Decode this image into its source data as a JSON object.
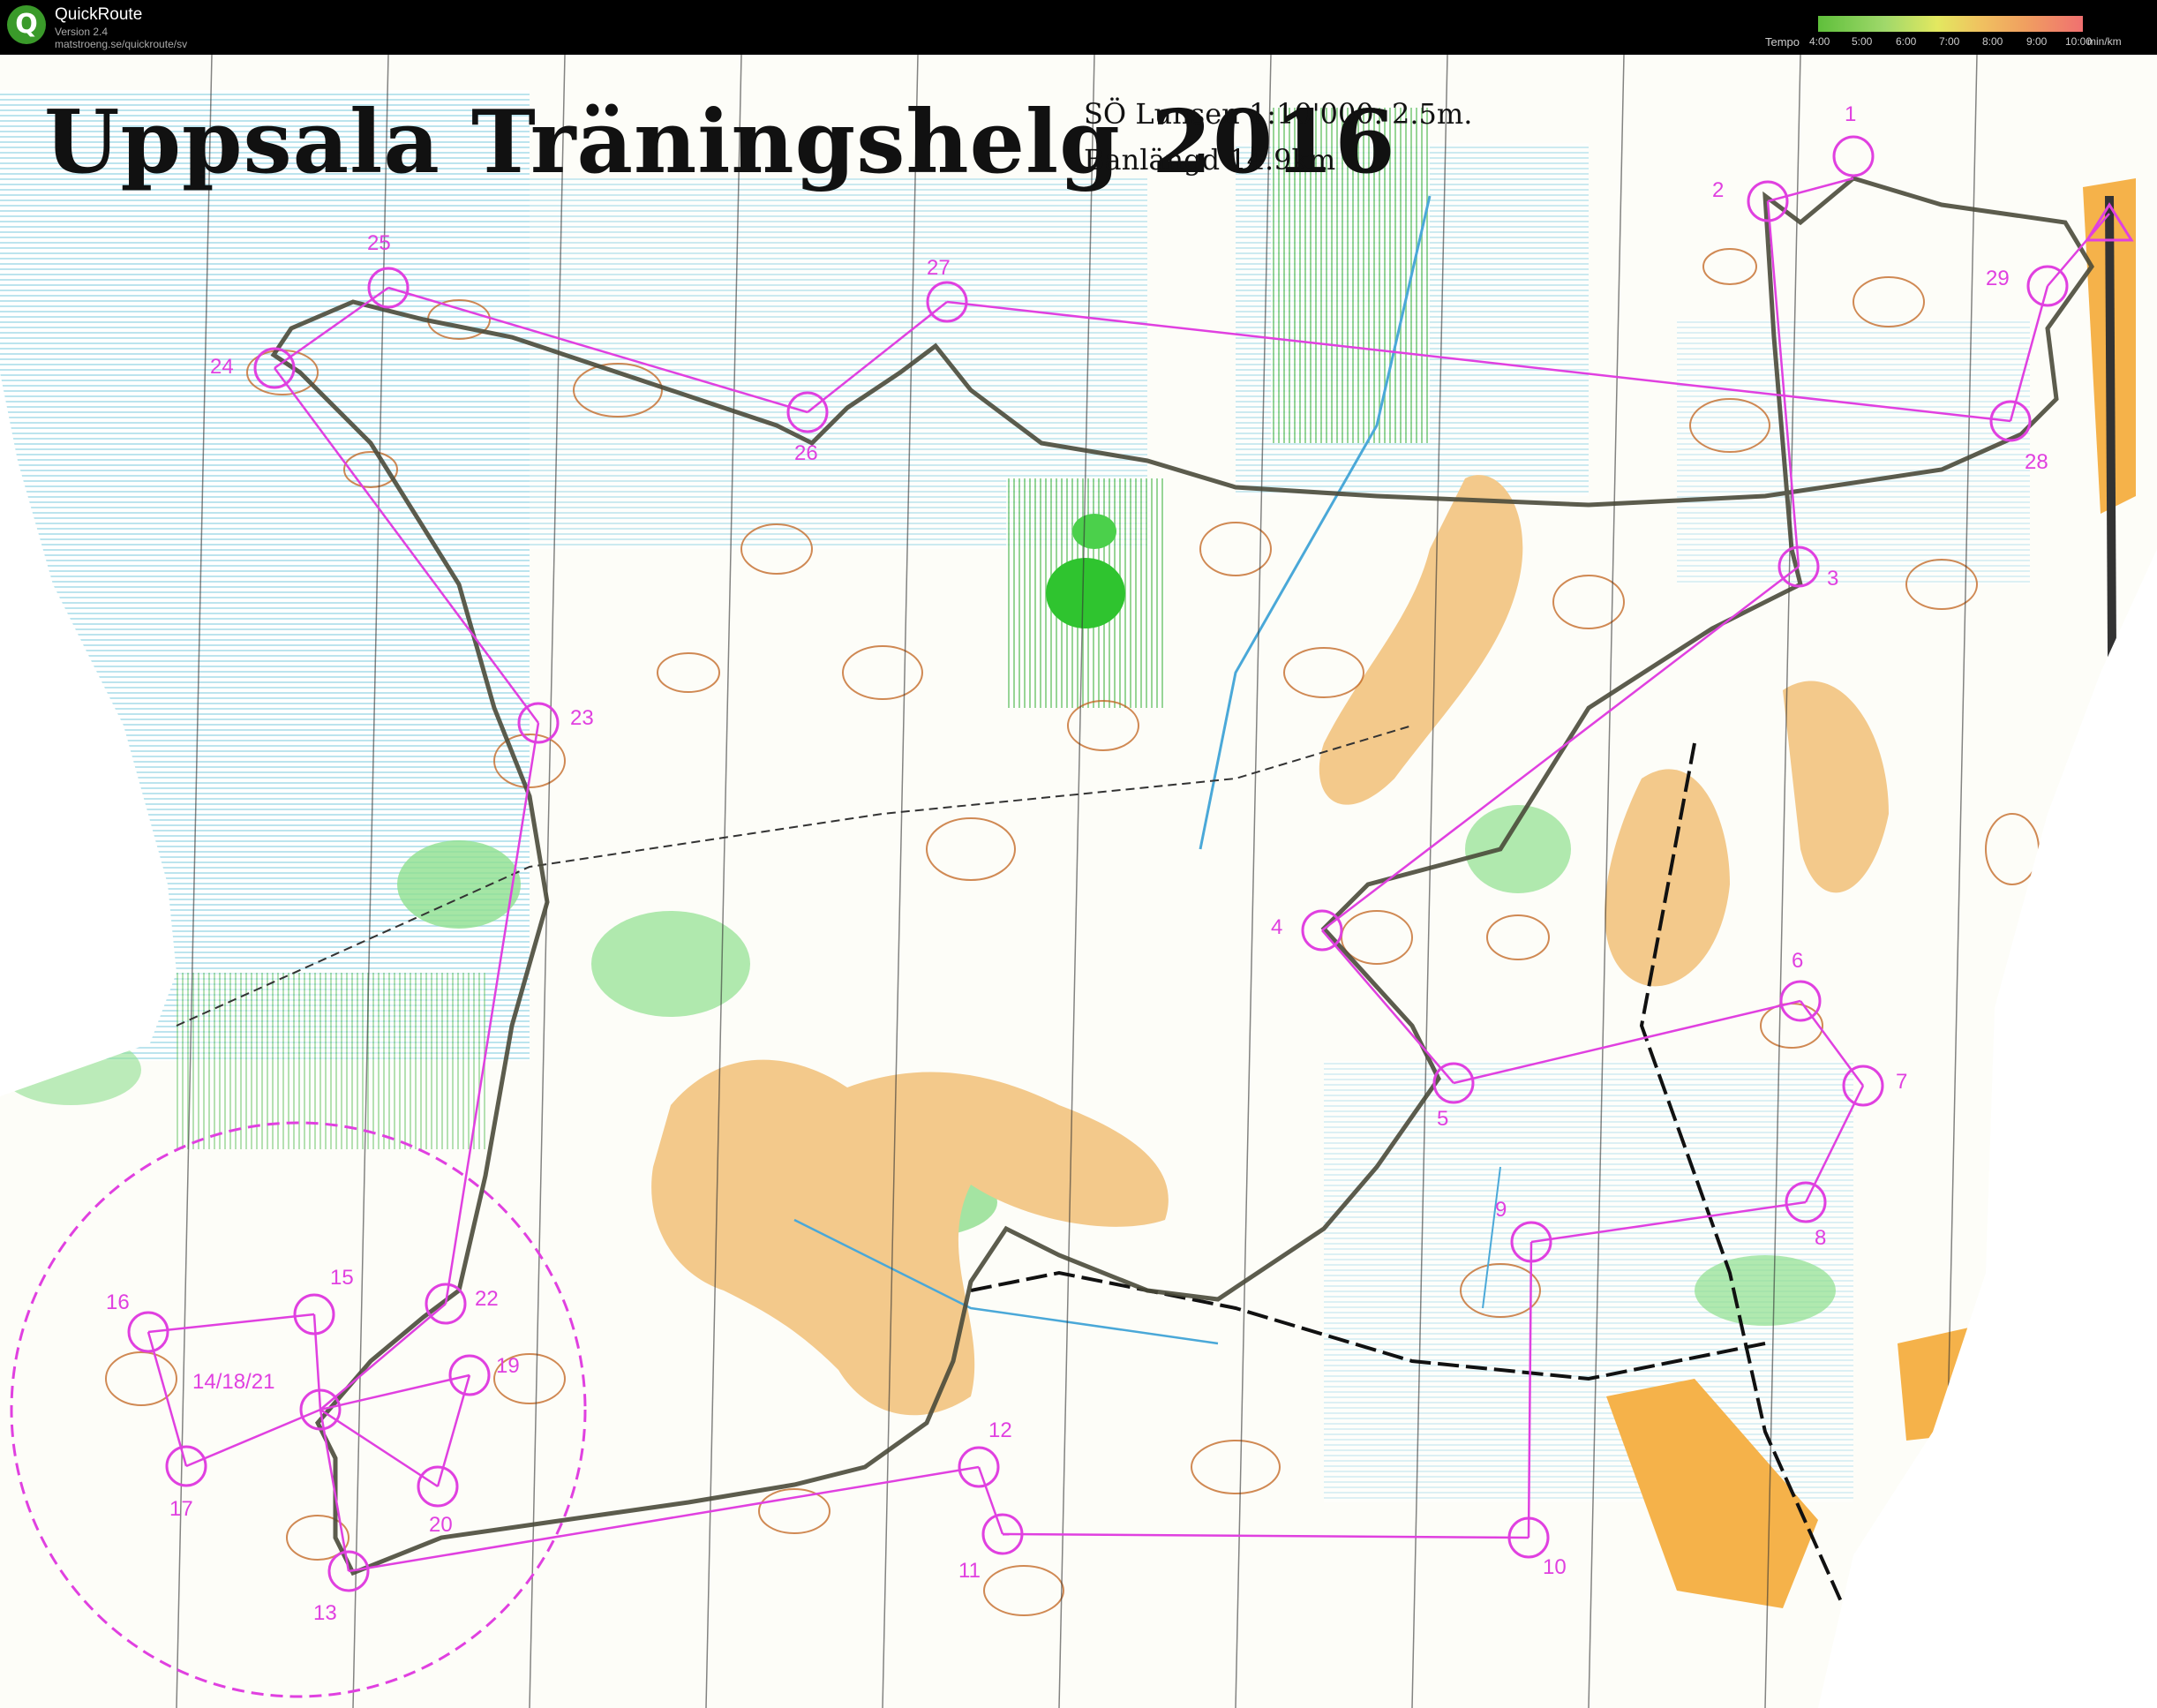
{
  "app": {
    "title": "QuickRoute",
    "version": "Version 2.4",
    "url": "matstroeng.se/quickroute/sv",
    "logo_letter": "Q"
  },
  "tempo": {
    "label": "Tempo",
    "ticks": [
      "4:00",
      "5:00",
      "6:00",
      "7:00",
      "8:00",
      "9:00",
      "10:00"
    ],
    "unit": "min/km"
  },
  "map": {
    "title": "Uppsala Träningshelg 2016",
    "info": "SÖ Lunsen 1:10'000. 2.5m.",
    "course_length": "Banlängd 14.9km",
    "colors": {
      "course": "#e040e0",
      "route": "#4a4a3a",
      "forest_white": "#ffffff",
      "green": "#6cd36c",
      "open_yellow": "#f3c98b",
      "marsh_blue": "#7fd0e0",
      "contour_brown": "#c0621c"
    }
  },
  "controls": [
    {
      "label": "1"
    },
    {
      "label": "2"
    },
    {
      "label": "3"
    },
    {
      "label": "4"
    },
    {
      "label": "5"
    },
    {
      "label": "6"
    },
    {
      "label": "7"
    },
    {
      "label": "8"
    },
    {
      "label": "9"
    },
    {
      "label": "10"
    },
    {
      "label": "11"
    },
    {
      "label": "12"
    },
    {
      "label": "13"
    },
    {
      "label": "14/18/21"
    },
    {
      "label": "15"
    },
    {
      "label": "16"
    },
    {
      "label": "17"
    },
    {
      "label": "19"
    },
    {
      "label": "20"
    },
    {
      "label": "22"
    },
    {
      "label": "23"
    },
    {
      "label": "24"
    },
    {
      "label": "25"
    },
    {
      "label": "26"
    },
    {
      "label": "27"
    },
    {
      "label": "28"
    },
    {
      "label": "29"
    }
  ]
}
